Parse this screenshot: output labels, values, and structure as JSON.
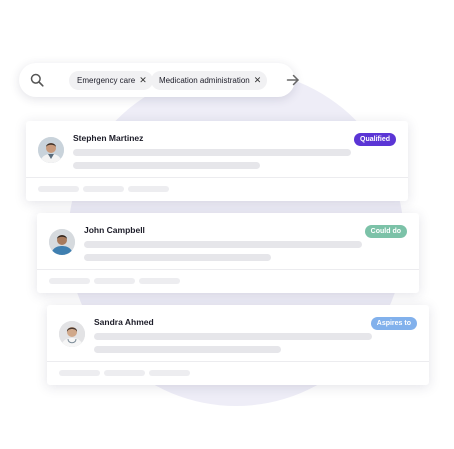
{
  "search": {
    "chips": [
      {
        "label": "Emergency care"
      },
      {
        "label": "Medication administration"
      }
    ]
  },
  "cards": [
    {
      "name": "Stephen Martinez",
      "badge": "Qualified",
      "badge_color": "#5b35d5"
    },
    {
      "name": "John Campbell",
      "badge": "Could do",
      "badge_color": "#7cc2a8"
    },
    {
      "name": "Sandra Ahmed",
      "badge": "Aspires to",
      "badge_color": "#82b1ec"
    }
  ],
  "icons": {
    "search": "search-icon",
    "remove": "close-icon",
    "submit": "arrow-right-icon"
  }
}
